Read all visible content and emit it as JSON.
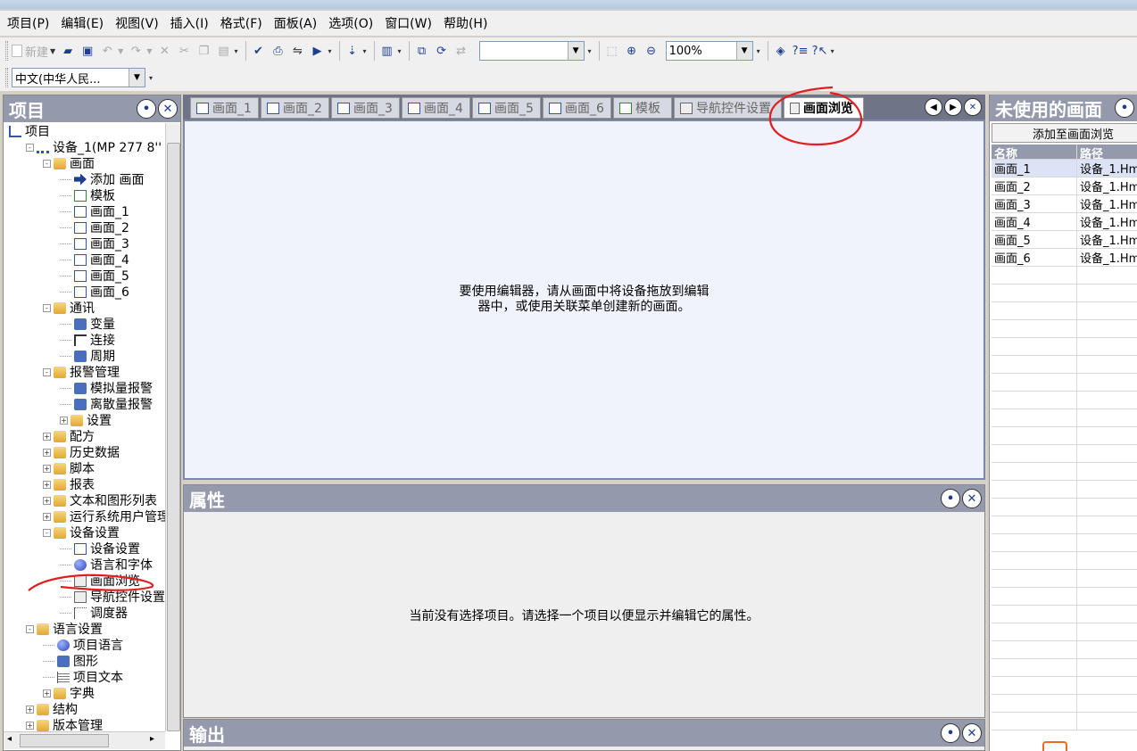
{
  "menubar": {
    "items": [
      "项目(P)",
      "编辑(E)",
      "视图(V)",
      "插入(I)",
      "格式(F)",
      "面板(A)",
      "选项(O)",
      "窗口(W)",
      "帮助(H)"
    ]
  },
  "toolbar": {
    "new_label": "新建",
    "zoom_value": "100%",
    "language_value": "中文(中华人民..."
  },
  "project_panel": {
    "title": "项目",
    "tree": [
      {
        "label": "项目",
        "icon": "project-icon"
      },
      {
        "label": "设备_1(MP 277 8''",
        "icon": "device-icon"
      },
      {
        "label": "画面",
        "icon": "folder-icon"
      },
      {
        "label": "添加 画面",
        "icon": "add-screen-icon"
      },
      {
        "label": "模板",
        "icon": "template-icon"
      },
      {
        "label": "画面_1",
        "icon": "screen-icon"
      },
      {
        "label": "画面_2",
        "icon": "screen-icon"
      },
      {
        "label": "画面_3",
        "icon": "screen-icon"
      },
      {
        "label": "画面_4",
        "icon": "screen-icon"
      },
      {
        "label": "画面_5",
        "icon": "screen-icon"
      },
      {
        "label": "画面_6",
        "icon": "screen-icon"
      },
      {
        "label": "通讯",
        "icon": "folder-icon"
      },
      {
        "label": "变量",
        "icon": "tag-icon"
      },
      {
        "label": "连接",
        "icon": "connection-icon"
      },
      {
        "label": "周期",
        "icon": "cycle-icon"
      },
      {
        "label": "报警管理",
        "icon": "folder-icon"
      },
      {
        "label": "模拟量报警",
        "icon": "analog-alarm-icon"
      },
      {
        "label": "离散量报警",
        "icon": "discrete-alarm-icon"
      },
      {
        "label": "设置",
        "icon": "settings-folder-icon"
      },
      {
        "label": "配方",
        "icon": "folder-icon"
      },
      {
        "label": "历史数据",
        "icon": "folder-icon"
      },
      {
        "label": "脚本",
        "icon": "folder-icon"
      },
      {
        "label": "报表",
        "icon": "folder-icon"
      },
      {
        "label": "文本和图形列表",
        "icon": "folder-icon"
      },
      {
        "label": "运行系统用户管理",
        "icon": "folder-icon"
      },
      {
        "label": "设备设置",
        "icon": "folder-icon"
      },
      {
        "label": "设备设置",
        "icon": "device-settings-icon"
      },
      {
        "label": "语言和字体",
        "icon": "globe-icon"
      },
      {
        "label": "画面浏览",
        "icon": "screen-navigation-icon"
      },
      {
        "label": "导航控件设置",
        "icon": "navigation-control-icon"
      },
      {
        "label": "调度器",
        "icon": "scheduler-icon"
      },
      {
        "label": "语言设置",
        "icon": "folder-icon"
      },
      {
        "label": "项目语言",
        "icon": "globe-icon"
      },
      {
        "label": "图形",
        "icon": "graphics-icon"
      },
      {
        "label": "项目文本",
        "icon": "text-icon"
      },
      {
        "label": "字典",
        "icon": "folder-icon"
      },
      {
        "label": "结构",
        "icon": "folder-icon"
      },
      {
        "label": "版本管理",
        "icon": "folder-icon"
      }
    ]
  },
  "editor": {
    "tabs": [
      "画面_1",
      "画面_2",
      "画面_3",
      "画面_4",
      "画面_5",
      "画面_6",
      "模板",
      "导航控件设置",
      "画面浏览"
    ],
    "active_tab": "画面浏览",
    "message": "要使用编辑器，请从画面中将设备拖放到编辑器中，或使用关联菜单创建新的画面。"
  },
  "properties_panel": {
    "title": "属性",
    "message": "当前没有选择项目。请选择一个项目以便显示并编辑它的属性。"
  },
  "output_panel": {
    "title": "输出"
  },
  "unused_screens_panel": {
    "title": "未使用的画面",
    "add_all_button": "添加至画面浏览",
    "columns": [
      "名称",
      "路径"
    ],
    "rows": [
      {
        "name": "画面_1",
        "path": "设备_1.Hm"
      },
      {
        "name": "画面_2",
        "path": "设备_1.Hm"
      },
      {
        "name": "画面_3",
        "path": "设备_1.Hm"
      },
      {
        "name": "画面_4",
        "path": "设备_1.Hm"
      },
      {
        "name": "画面_5",
        "path": "设备_1.Hm"
      },
      {
        "name": "画面_6",
        "path": "设备_1.Hm"
      }
    ]
  },
  "colors": {
    "panel_header": "#949aab",
    "tab_strip": "#6f7486",
    "editor_bg": "#f0f3fb",
    "annotation_red": "#e02020"
  }
}
